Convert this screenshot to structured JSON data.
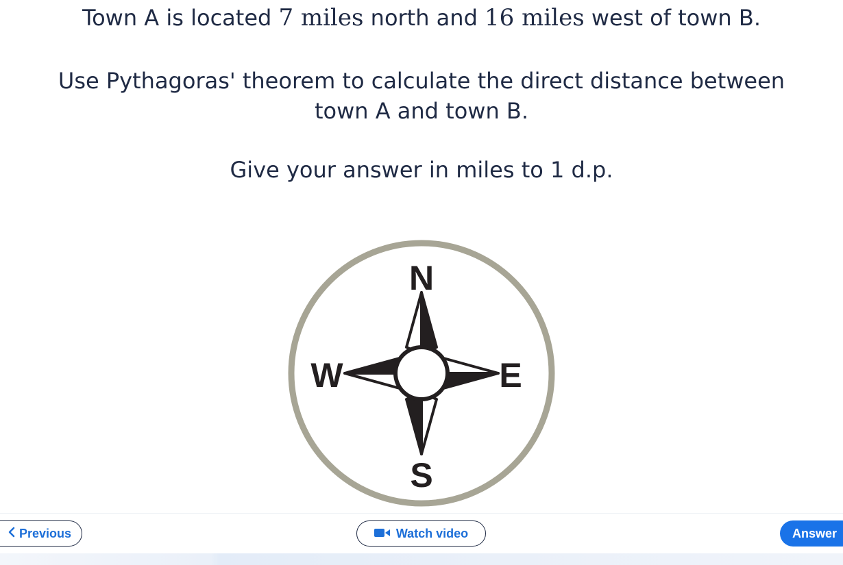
{
  "question": {
    "line1_pre": "Town A is located ",
    "north_miles": "7 miles",
    "line1_mid": " north and ",
    "west_miles": "16 miles",
    "line1_post": " west of town B.",
    "line2": "Use Pythagoras' theorem to calculate the direct distance between",
    "line2b": "town A and town B.",
    "line3": "Give your answer in miles to 1 d.p."
  },
  "compass": {
    "north": "N",
    "east": "E",
    "south": "S",
    "west": "W",
    "ring_color": "#a7a595",
    "needle_color": "#231f20"
  },
  "footer": {
    "previous": "Previous",
    "watch_video": "Watch video",
    "answer": "Answer"
  },
  "colors": {
    "accent": "#1a73e8",
    "text": "#1f2a44"
  }
}
